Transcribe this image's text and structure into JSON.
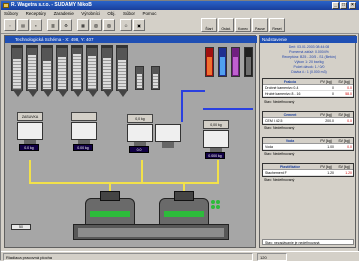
{
  "window": {
    "title": "R. Wagetra s.r.o. - SUDAMY NikoB"
  },
  "menu": [
    "Súbory",
    "Receptúry",
    "Zaradenie",
    "Výrobníci",
    "Obj.",
    "Súbor",
    "Pomoc"
  ],
  "toolbar": {
    "buttons": [
      "Štart",
      "Ostat.",
      "Konec",
      "Pause",
      "Reset"
    ]
  },
  "schema": {
    "title": "Technologická Schéma - X: 498, Y: 407",
    "scales": [
      "ZASUVKA",
      "",
      "0,0 kg",
      "0,00 kg"
    ],
    "weights": [
      "0.0 kg",
      "0.00 kg",
      "0.0",
      "0.000 kg"
    ],
    "indicator": "50"
  },
  "panel": {
    "title": "Nadstavenie",
    "info": [
      "Deň: 03.01.2003 08:44:08",
      "Pomerná záťaž: 0.0004%",
      "Receptúra: B25 - 20/5 - S1 (Betón)",
      "Výkon 1: 20 bar/kg",
      "Počet dávok: 1 / 0/0",
      "Dávka č.: 1 (0.000 m3)"
    ],
    "groups": [
      {
        "name": "Frakcia",
        "cols": [
          "PV [kg]",
          "SV [kg]"
        ],
        "rows": [
          [
            "Drobné kamenivo 0-4",
            "0",
            "0.0"
          ],
          [
            "Hrubé kamenivo 8 - 16",
            "0",
            "58.0"
          ]
        ],
        "status": "Stav: Nedefinovaný"
      },
      {
        "name": "Cement",
        "cols": [
          "PV [kg]",
          "SV [kg]"
        ],
        "rows": [
          [
            "CEM I 42.5",
            "200.0",
            "0.0"
          ]
        ],
        "status": "Stav: Nedefinovaný"
      },
      {
        "name": "Voda",
        "cols": [
          "PV [kg]",
          "SV [kg]"
        ],
        "rows": [
          [
            "Voda",
            "1.00",
            "0.0"
          ]
        ],
        "status": "Stav: Nedefinovaný"
      },
      {
        "name": "Plastifikátor",
        "cols": [
          "PV [kg]",
          "SV [kg]"
        ],
        "rows": [
          [
            "Stachement F",
            "1.20",
            "1.20"
          ]
        ],
        "status": "Stav: Nedefinovaný"
      }
    ],
    "footer": "Stav: nezadávanie je nedefinovaná"
  },
  "status": {
    "left": "Riadiaca pracovná plocha",
    "right": "120"
  }
}
